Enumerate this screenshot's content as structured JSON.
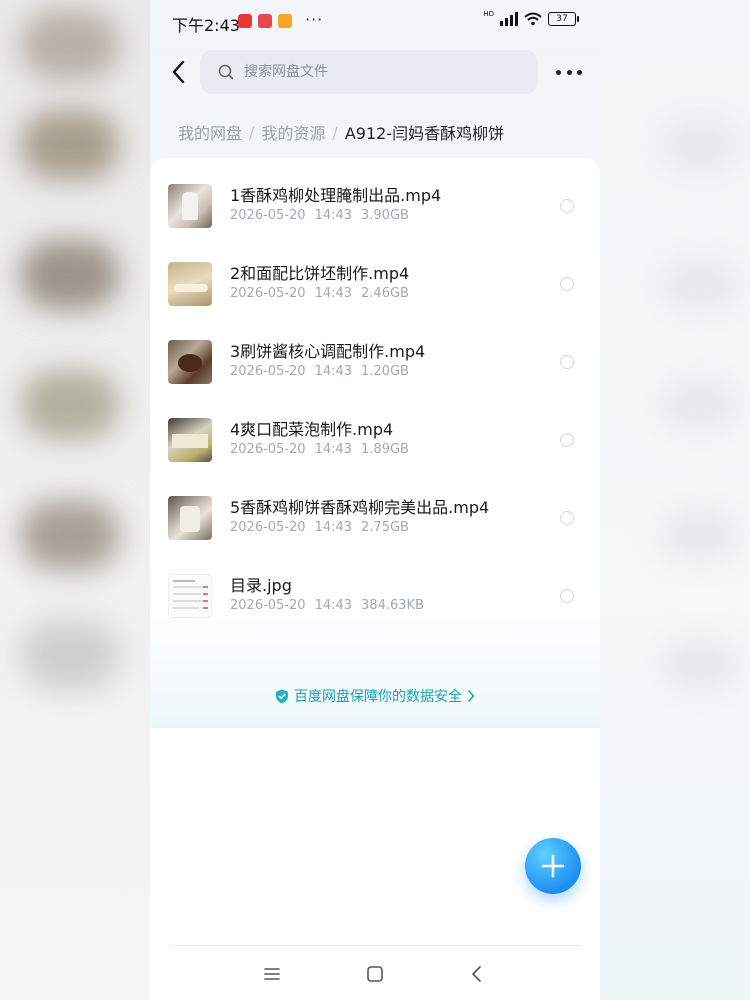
{
  "status_bar": {
    "time": "下午2:43",
    "more": "···",
    "network": "HD",
    "battery": "37"
  },
  "search": {
    "placeholder": "搜索网盘文件"
  },
  "breadcrumb": [
    {
      "label": "我的网盘"
    },
    {
      "label": "我的资源"
    },
    {
      "label": "A912-闫妈香酥鸡柳饼"
    }
  ],
  "files": [
    {
      "name": "1香酥鸡柳处理腌制出品.mp4",
      "date": "2026-05-20",
      "time": "14:43",
      "size": "3.90GB",
      "thumb": "video-thumbnail"
    },
    {
      "name": "2和面配比饼坯制作.mp4",
      "date": "2026-05-20",
      "time": "14:43",
      "size": "2.46GB",
      "thumb": "video-thumbnail"
    },
    {
      "name": "3刷饼酱核心调配制作.mp4",
      "date": "2026-05-20",
      "time": "14:43",
      "size": "1.20GB",
      "thumb": "video-thumbnail"
    },
    {
      "name": "4爽口配菜泡制作.mp4",
      "date": "2026-05-20",
      "time": "14:43",
      "size": "1.89GB",
      "thumb": "video-thumbnail"
    },
    {
      "name": "5香酥鸡柳饼香酥鸡柳完美出品.mp4",
      "date": "2026-05-20",
      "time": "14:43",
      "size": "2.75GB",
      "thumb": "video-thumbnail"
    },
    {
      "name": "目录.jpg",
      "date": "2026-05-20",
      "time": "14:43",
      "size": "384.63KB",
      "thumb": "image-thumbnail"
    }
  ],
  "security_text": "百度网盘保障你的数据安全",
  "colors": {
    "accent": "#1aa3b8",
    "fab": "#1e8ff2",
    "search_bg": "#e8ecf2"
  },
  "icons": [
    "back-arrow-icon",
    "search-icon",
    "more-dots-icon",
    "shield-icon",
    "chevron-right-icon",
    "plus-icon",
    "menu-icon",
    "home-square-icon",
    "back-chevron-icon"
  ]
}
